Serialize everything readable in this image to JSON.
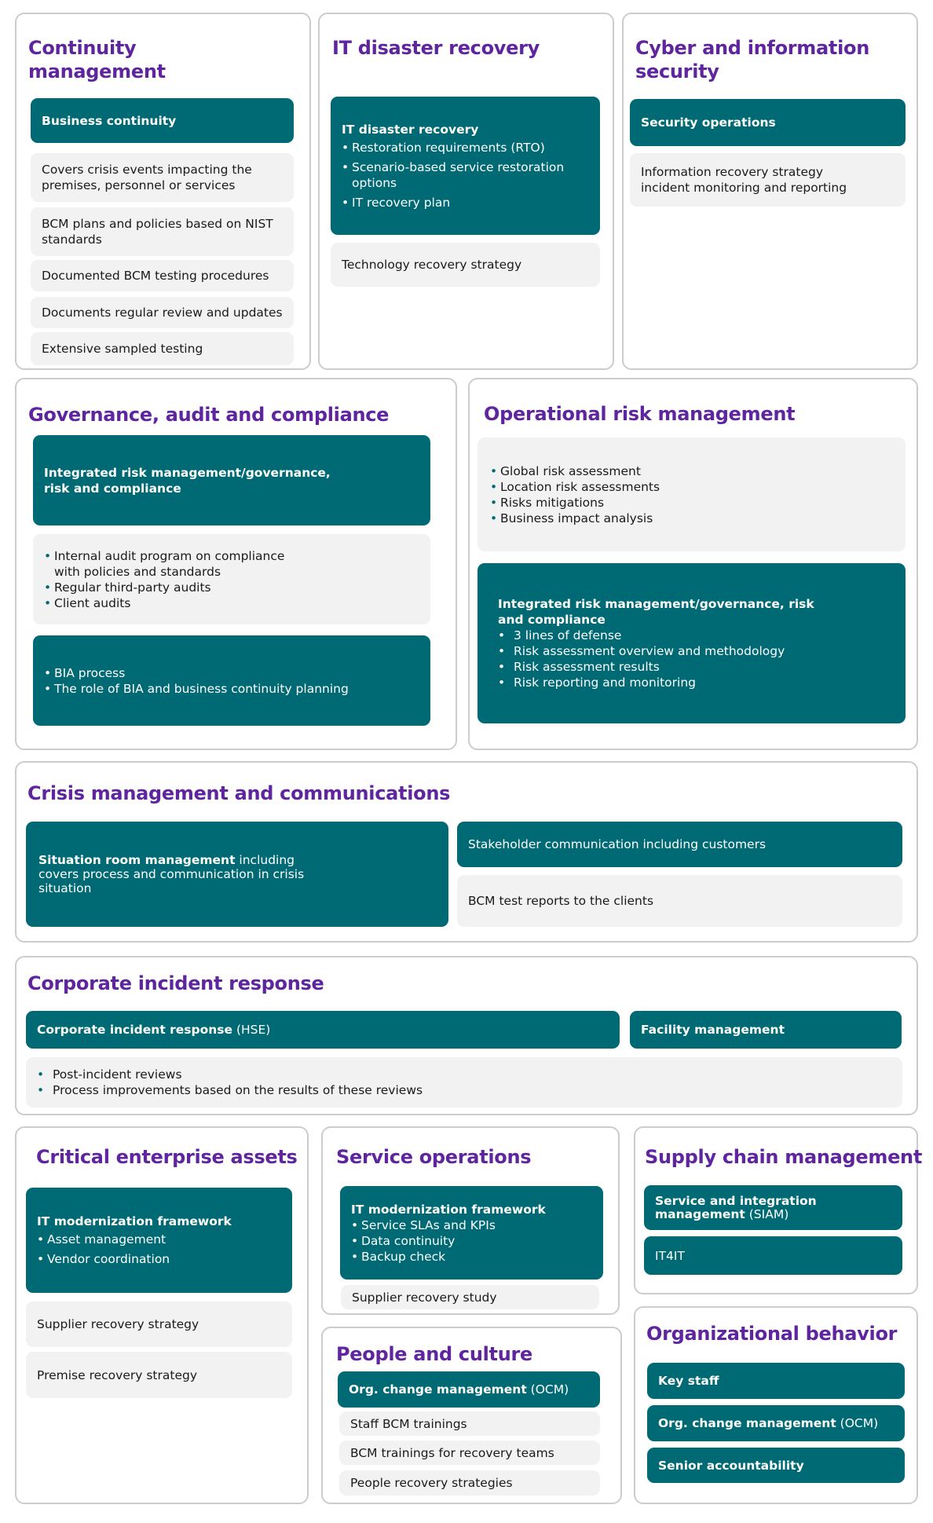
{
  "colors": {
    "title": "#5f259f",
    "teal": "#006a74",
    "gray": "#f2f2f2",
    "border": "#cccccc"
  },
  "continuity": {
    "title": "Continuity management",
    "header": "Business continuity",
    "items": [
      "Covers crisis events impacting the premises, personnel or services",
      "BCM plans and policies based on NIST standards",
      "Documented BCM testing procedures",
      "Documents regular review and updates",
      "Extensive sampled testing"
    ]
  },
  "it_dr": {
    "title": "IT disaster recovery",
    "header": "IT disaster recovery",
    "bullets": [
      "Restoration requirements (RTO)",
      "Scenario-based service restoration options",
      "IT recovery plan"
    ],
    "item": "Technology recovery strategy"
  },
  "cyber": {
    "title": "Cyber and information security",
    "header": "Security operations",
    "item_line1": "Information recovery strategy",
    "item_line2": "incident monitoring and reporting"
  },
  "governance": {
    "title": "Governance, audit and compliance",
    "header_line1": "Integrated risk management/governance,",
    "header_line2": "risk and compliance",
    "audit_bullets": [
      "Internal audit program on compliance with policies and standards",
      "Regular third-party audits",
      "Client audits"
    ],
    "bia_bullets": [
      "BIA process",
      "The role of BIA and business continuity planning"
    ]
  },
  "orm": {
    "title": "Operational risk management",
    "risk_bullets": [
      "Global risk assessment",
      "Location risk assessments",
      "Risks mitigations",
      "Business impact analysis"
    ],
    "header": "Integrated risk management/governance, risk and compliance",
    "grc_bullets": [
      "3 lines of defense",
      "Risk assessment overview and methodology",
      "Risk assessment results",
      "Risk reporting and monitoring"
    ]
  },
  "crisis": {
    "title": "Crisis management and communications",
    "situation_bold": "Situation room management",
    "situation_rest": " including covers process and communication in crisis situation",
    "stakeholder": "Stakeholder communication including customers",
    "bcm_reports": "BCM test reports to the clients"
  },
  "incident": {
    "title": "Corporate incident response",
    "cir_bold": "Corporate incident response",
    "cir_rest": " (HSE)",
    "facility": "Facility management",
    "bullets": [
      "Post-incident reviews",
      "Process improvements based on the results of these reviews"
    ]
  },
  "assets": {
    "title": "Critical enterprise assets",
    "header": "IT modernization framework",
    "bullets": [
      "Asset management",
      "Vendor coordination"
    ],
    "items": [
      "Supplier recovery strategy",
      "Premise recovery strategy"
    ]
  },
  "service_ops": {
    "title": "Service operations",
    "header": "IT modernization framework",
    "bullets": [
      "Service SLAs and KPIs",
      "Data continuity",
      "Backup check"
    ],
    "item": "Supplier recovery study"
  },
  "people": {
    "title": "People and culture",
    "ocm_bold": "Org. change management",
    "ocm_rest": " (OCM)",
    "items": [
      "Staff BCM trainings",
      "BCM trainings for recovery teams",
      "People recovery strategies"
    ]
  },
  "supply": {
    "title": "Supply chain management",
    "siam_bold": "Service and integration management",
    "siam_rest": " (SIAM)",
    "it4it": "IT4IT"
  },
  "org_behavior": {
    "title": "Organizational behavior",
    "key_staff": "Key staff",
    "ocm_bold": "Org. change management",
    "ocm_rest": " (OCM)",
    "senior": "Senior accountability"
  }
}
